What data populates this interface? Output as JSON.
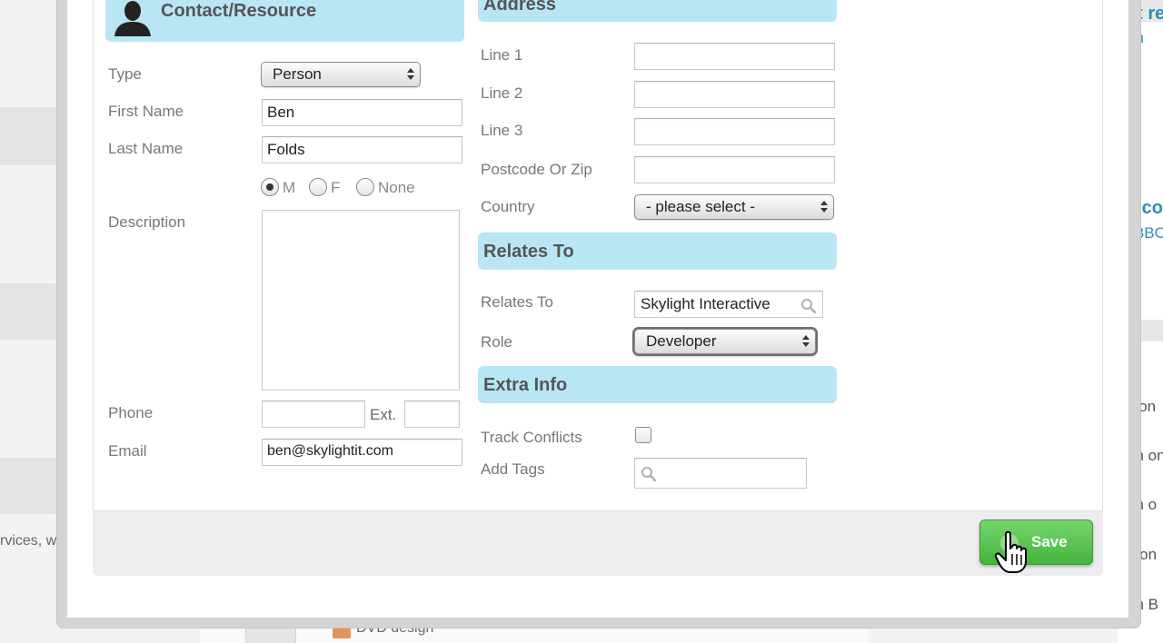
{
  "background": {
    "left_text": "rvices, wh",
    "right_links": [
      "ct re",
      "gn",
      "y co",
      "' BBC",
      "s on",
      "an on",
      "an o",
      "n on",
      "on B"
    ],
    "bottom_item": "DVD design"
  },
  "contact": {
    "header": "Contact/Resource",
    "type_label": "Type",
    "type_value": "Person",
    "first_name_label": "First Name",
    "first_name_value": "Ben",
    "last_name_label": "Last Name",
    "last_name_value": "Folds",
    "gender_options": [
      "M",
      "F",
      "None"
    ],
    "gender_selected": "M",
    "description_label": "Description",
    "phone_label": "Phone",
    "ext_label": "Ext.",
    "email_label": "Email",
    "email_value": "ben@skylightit.com"
  },
  "address": {
    "header": "Address",
    "line1_label": "Line 1",
    "line2_label": "Line 2",
    "line3_label": "Line 3",
    "postcode_label": "Postcode Or Zip",
    "country_label": "Country",
    "country_value": "- please select -"
  },
  "relates": {
    "header": "Relates To",
    "relates_label": "Relates To",
    "relates_value": "Skylight Interactive",
    "role_label": "Role",
    "role_value": "Developer"
  },
  "extra": {
    "header": "Extra Info",
    "track_label": "Track Conflicts",
    "tags_label": "Add Tags"
  },
  "footer": {
    "save_label": "Save"
  },
  "colors": {
    "section_header_bg": "#b9e6f5",
    "save_green": "#4fbf46"
  }
}
